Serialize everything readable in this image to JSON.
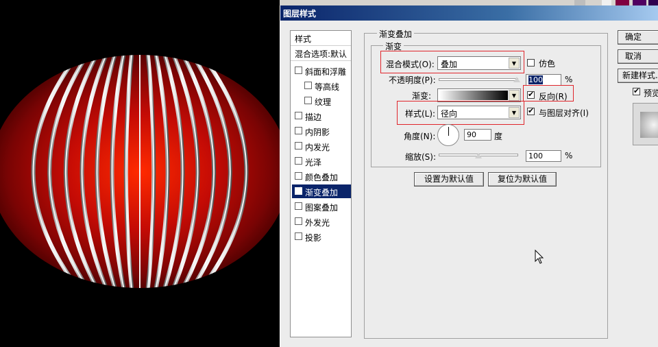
{
  "dialog": {
    "title": "图层样式"
  },
  "style_list": {
    "header": "样式",
    "blend_options": "混合选项:默认",
    "items": [
      {
        "label": "斜面和浮雕",
        "checked": false,
        "sub": false,
        "active": false
      },
      {
        "label": "等高线",
        "checked": false,
        "sub": true,
        "active": false
      },
      {
        "label": "纹理",
        "checked": false,
        "sub": true,
        "active": false
      },
      {
        "label": "描边",
        "checked": false,
        "sub": false,
        "active": false
      },
      {
        "label": "内阴影",
        "checked": false,
        "sub": false,
        "active": false
      },
      {
        "label": "内发光",
        "checked": false,
        "sub": false,
        "active": false
      },
      {
        "label": "光泽",
        "checked": false,
        "sub": false,
        "active": false
      },
      {
        "label": "颜色叠加",
        "checked": false,
        "sub": false,
        "active": false
      },
      {
        "label": "渐变叠加",
        "checked": true,
        "sub": false,
        "active": true
      },
      {
        "label": "图案叠加",
        "checked": false,
        "sub": false,
        "active": false
      },
      {
        "label": "外发光",
        "checked": false,
        "sub": false,
        "active": false
      },
      {
        "label": "投影",
        "checked": false,
        "sub": false,
        "active": false
      }
    ]
  },
  "panel": {
    "group_title": "渐变叠加",
    "subgroup_title": "渐变",
    "blend_mode_label": "混合模式(O):",
    "blend_mode_value": "叠加",
    "dither_label": "仿色",
    "opacity_label": "不透明度(P):",
    "opacity_value": "100",
    "opacity_unit": "%",
    "opacity_fraction": 1.0,
    "gradient_label": "渐变:",
    "reverse_label": "反向(R)",
    "style_label": "样式(L):",
    "style_value": "径向",
    "align_label": "与图层对齐(I)",
    "angle_label": "角度(N):",
    "angle_value": "90",
    "angle_unit": "度",
    "scale_label": "缩放(S):",
    "scale_value": "100",
    "scale_unit": "%",
    "scale_fraction": 0.5,
    "make_default_button": "设置为默认值",
    "reset_default_button": "复位为默认值"
  },
  "right_buttons": {
    "ok": "确定",
    "cancel": "取消",
    "new_style": "新建样式...",
    "preview_label": "预览"
  },
  "colors": {
    "highlight": "#0a246a",
    "annotation_red": "#e0242a",
    "lantern_center": "#ff2a00",
    "lantern_edge": "#3a0000"
  }
}
